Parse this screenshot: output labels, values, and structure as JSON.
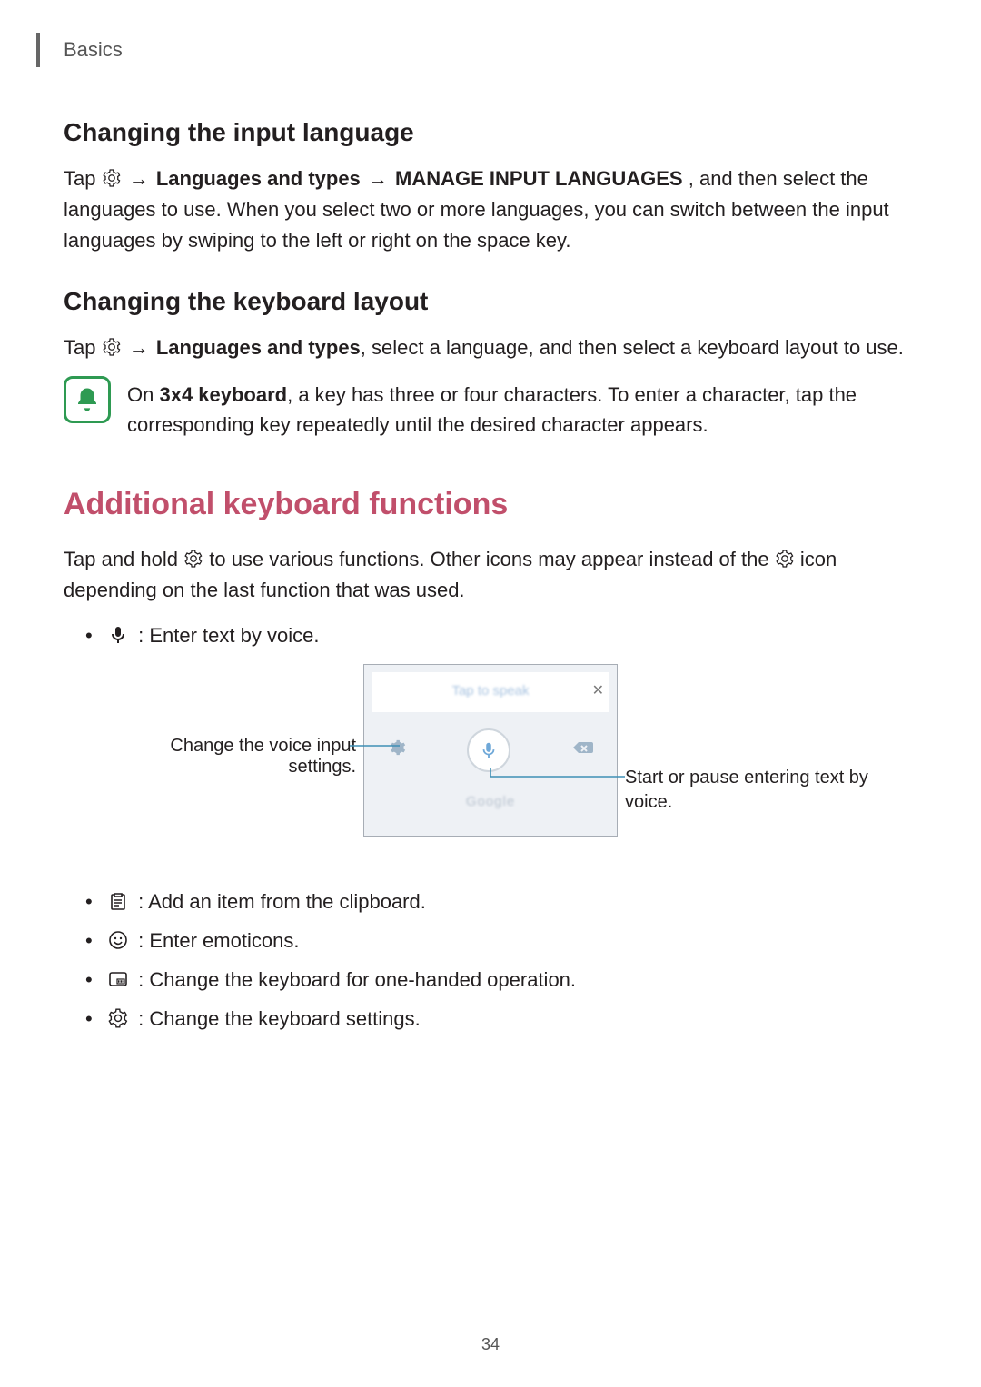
{
  "header": {
    "label": "Basics"
  },
  "section_input_lang": {
    "heading": "Changing the input language",
    "p_pre": "Tap ",
    "p_navpath_1": "Languages and types",
    "p_navpath_2": "MANAGE INPUT LANGUAGES",
    "p_post": ", and then select the languages to use. When you select two or more languages, you can switch between the input languages by swiping to the left or right on the space key."
  },
  "section_kbd_layout": {
    "heading": "Changing the keyboard layout",
    "p_pre": "Tap ",
    "p_navpath_1": "Languages and types",
    "p_post": ", select a language, and then select a keyboard layout to use.",
    "note_pre": "On ",
    "note_bold": "3x4 keyboard",
    "note_post": ", a key has three or four characters. To enter a character, tap the corresponding key repeatedly until the desired character appears."
  },
  "section_additional": {
    "heading": "Additional keyboard functions",
    "p1_a": "Tap and hold ",
    "p1_b": " to use various functions. Other icons may appear instead of the ",
    "p1_c": " icon depending on the last function that was used.",
    "list": {
      "voice": ": Enter text by voice.",
      "clipboard": ": Add an item from the clipboard.",
      "emoticons": ": Enter emoticons.",
      "onehand": ": Change the keyboard for one-handed operation.",
      "settings": ": Change the keyboard settings."
    }
  },
  "voice_figure": {
    "placeholder": "Tap to speak",
    "brand": "Google",
    "left_label": "Change the voice input settings.",
    "right_label": "Start or pause entering text by voice."
  },
  "arrow": "→",
  "page_number": "34"
}
